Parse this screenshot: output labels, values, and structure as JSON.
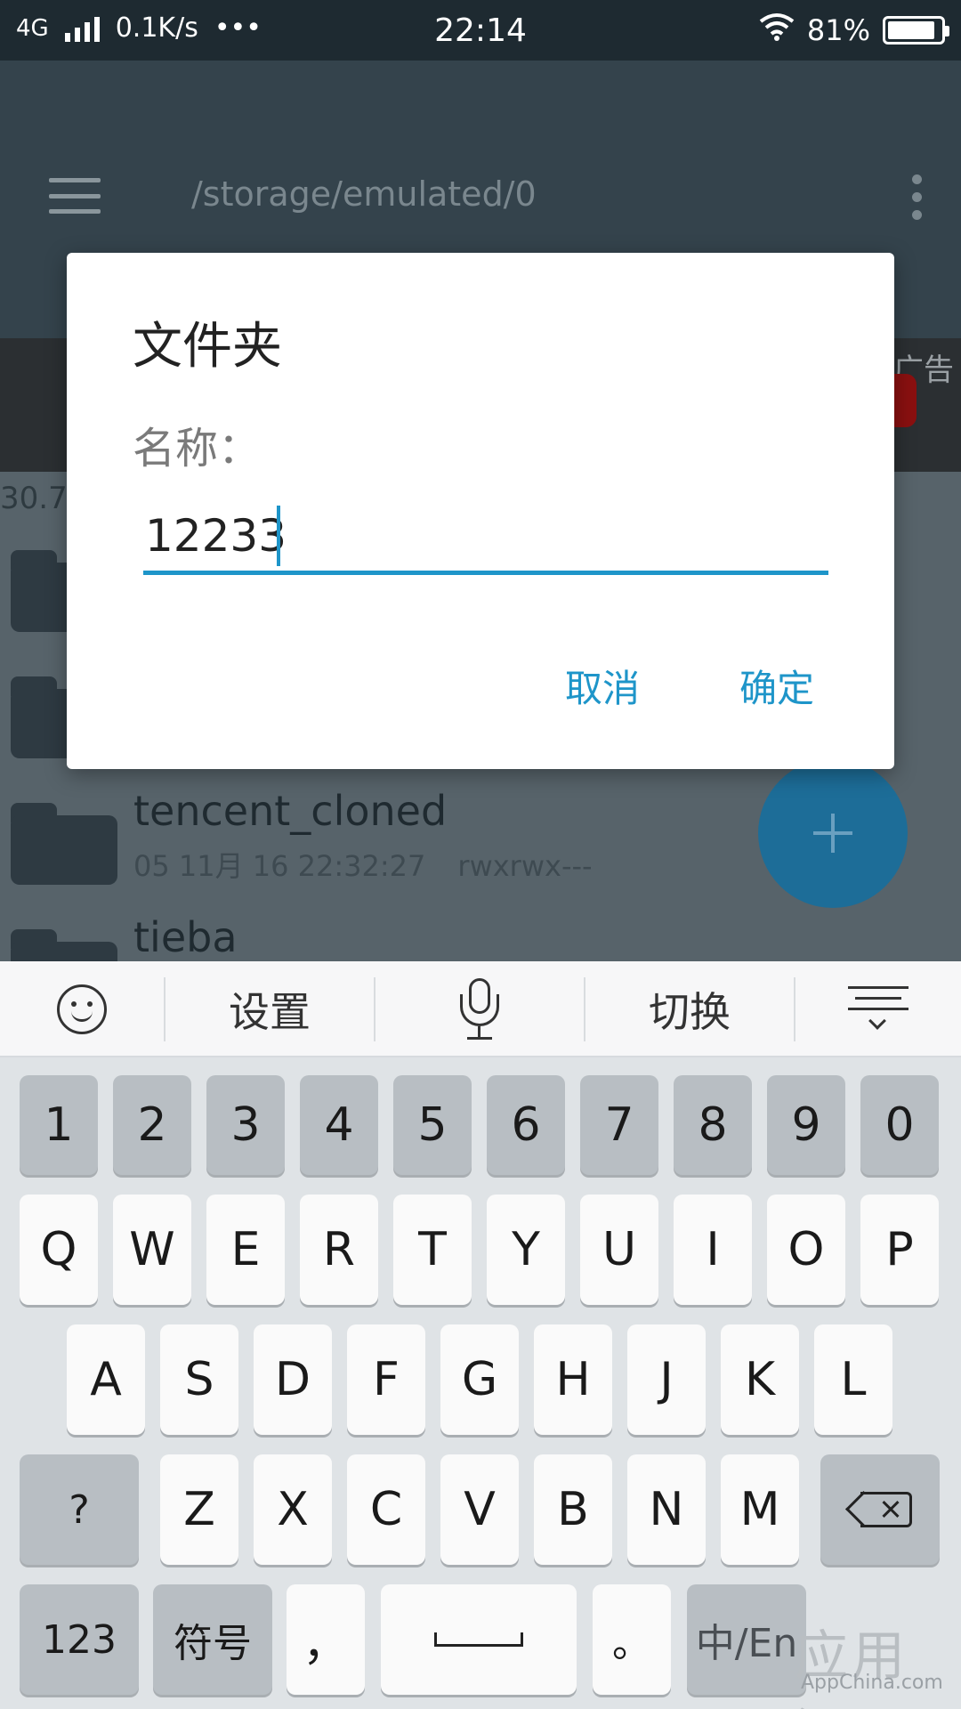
{
  "status_bar": {
    "network": "4G",
    "speed": "0.1K/s",
    "dots": "•••",
    "time": "22:14",
    "battery": "81%",
    "battery_level": 0.81
  },
  "app_bar": {
    "path": "/storage/emulated/0"
  },
  "ad": {
    "label": "广告"
  },
  "storage_info": "30.7",
  "files": [
    {
      "name": "",
      "date": "",
      "perm": ""
    },
    {
      "name": "",
      "date": "",
      "perm": ""
    },
    {
      "name": "tencent_cloned",
      "date": "05 11月 16 22:32:27",
      "perm": "rwxrwx---"
    },
    {
      "name": "tieba",
      "date": "",
      "perm": ""
    }
  ],
  "dialog": {
    "title": "文件夹",
    "label": "名称：",
    "value": "12233",
    "cancel": "取消",
    "ok": "确定"
  },
  "keyboard": {
    "toolbar": {
      "settings": "设置",
      "switch": "切换"
    },
    "row_numbers": [
      "1",
      "2",
      "3",
      "4",
      "5",
      "6",
      "7",
      "8",
      "9",
      "0"
    ],
    "row_q": [
      "Q",
      "W",
      "E",
      "R",
      "T",
      "Y",
      "U",
      "I",
      "O",
      "P"
    ],
    "row_a": [
      "A",
      "S",
      "D",
      "F",
      "G",
      "H",
      "J",
      "K",
      "L"
    ],
    "row_z": [
      "?",
      "Z",
      "X",
      "C",
      "V",
      "B",
      "N",
      "M"
    ],
    "bottom": {
      "num": "123",
      "symbols": "符号",
      "comma": "，",
      "period": "。",
      "lang": "中/En"
    }
  },
  "watermark": {
    "main": "应用汇",
    "sub": "AppChina.com"
  }
}
